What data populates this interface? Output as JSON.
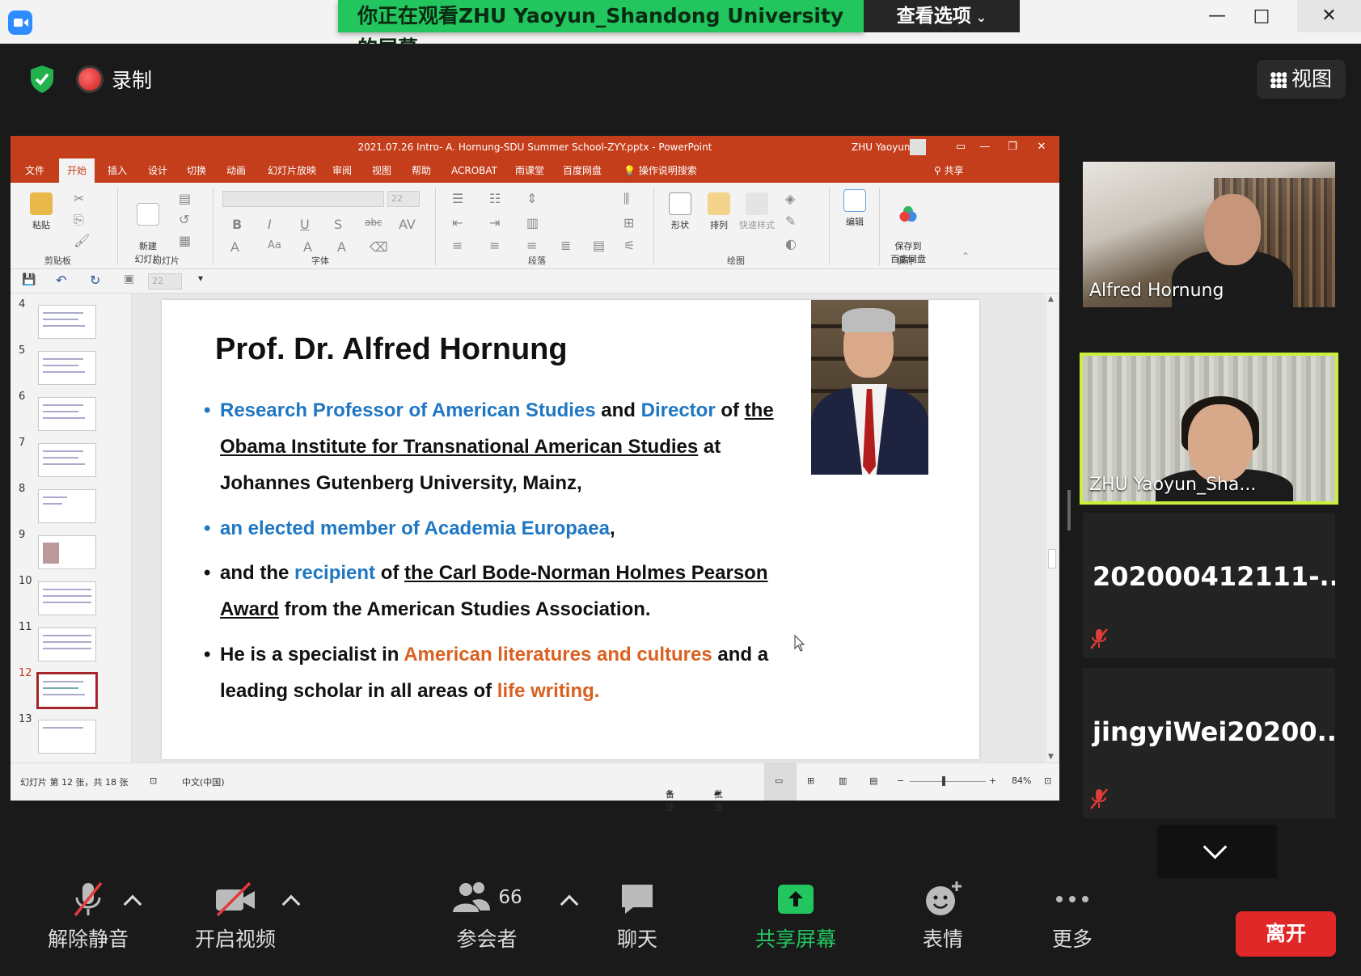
{
  "titlebar": {
    "banner": "你正在观看ZHU Yaoyun_Shandong University的屏幕",
    "view_options": "查看选项",
    "minimize": "—",
    "maximize": "□",
    "close": "✕"
  },
  "meeting": {
    "record_label": "录制",
    "view_label": "视图"
  },
  "powerpoint": {
    "title": "2021.07.26 Intro- A. Hornung-SDU Summer School-ZYY.pptx  -  PowerPoint",
    "user": "ZHU Yaoyun",
    "tabs": [
      "文件",
      "开始",
      "插入",
      "设计",
      "切换",
      "动画",
      "幻灯片放映",
      "审阅",
      "视图",
      "帮助",
      "ACROBAT",
      "雨课堂",
      "百度网盘",
      "操作说明搜索"
    ],
    "share": "共享",
    "ribbon": {
      "paste": "粘贴",
      "new_slide": "新建\n幻灯片",
      "shapes": "形状",
      "arrange": "排列",
      "quick_styles": "快速样式",
      "edit": "编辑",
      "save_baidu": "保存到\n百度网盘",
      "font_size": "22",
      "groups": [
        "剪贴板",
        "幻灯片",
        "字体",
        "段落",
        "绘图",
        "保存"
      ]
    },
    "qat_font_size": "22",
    "thumbnails": [
      "4",
      "5",
      "6",
      "7",
      "8",
      "9",
      "10",
      "11",
      "12",
      "13"
    ],
    "selected_slide": "12",
    "slide": {
      "title": "Prof. Dr. Alfred Hornung",
      "bullets": [
        {
          "parts": [
            {
              "text": "Research Professor of American Studies",
              "style": "blue"
            },
            {
              "text": " and ",
              "style": ""
            },
            {
              "text": "Director",
              "style": "blue"
            },
            {
              "text": " of ",
              "style": ""
            },
            {
              "text": "the Obama Institute for Transnational American Studies",
              "style": "ul"
            },
            {
              "text": " at Johannes Gutenberg University, Mainz,",
              "style": ""
            }
          ]
        },
        {
          "parts": [
            {
              "text": "an elected member of Academia Europaea",
              "style": "blue"
            },
            {
              "text": ",",
              "style": ""
            }
          ]
        },
        {
          "parts": [
            {
              "text": "and the ",
              "style": ""
            },
            {
              "text": "recipient",
              "style": "blue"
            },
            {
              "text": " of ",
              "style": ""
            },
            {
              "text": "the Carl Bode-Norman Holmes Pearson Award",
              "style": "ul"
            },
            {
              "text": " from the American Studies Association.",
              "style": ""
            }
          ]
        },
        {
          "parts": [
            {
              "text": "He is a specialist in ",
              "style": ""
            },
            {
              "text": "American literatures and cultures",
              "style": "orange"
            },
            {
              "text": " and a leading scholar in all areas of ",
              "style": ""
            },
            {
              "text": "life writing.",
              "style": "orange"
            }
          ]
        }
      ]
    },
    "status": {
      "slide_count": "幻灯片 第 12 张，共 18 张",
      "language": "中文(中国)",
      "notes": "备注",
      "comments": "批注",
      "zoom": "84%"
    }
  },
  "participants": [
    {
      "name": "Alfred Hornung",
      "video": true
    },
    {
      "name": "ZHU Yaoyun_Sha...",
      "video": true,
      "active_speaker": true
    },
    {
      "name": "202000412111-...",
      "video": false,
      "muted": true
    },
    {
      "name": "jingyiWei20200...",
      "video": false,
      "muted": true
    }
  ],
  "toolbar": {
    "unmute": "解除静音",
    "start_video": "开启视频",
    "participants": "参会者",
    "participant_count": "66",
    "chat": "聊天",
    "share_screen": "共享屏幕",
    "reactions": "表情",
    "more": "更多",
    "leave": "离开"
  },
  "colors": {
    "ppt_accent": "#c43e1c",
    "share_green": "#22c55e",
    "leave_red": "#e02828",
    "active_speaker": "#c9f03a",
    "slide_blue": "#1f77c3",
    "slide_orange": "#d96020"
  }
}
